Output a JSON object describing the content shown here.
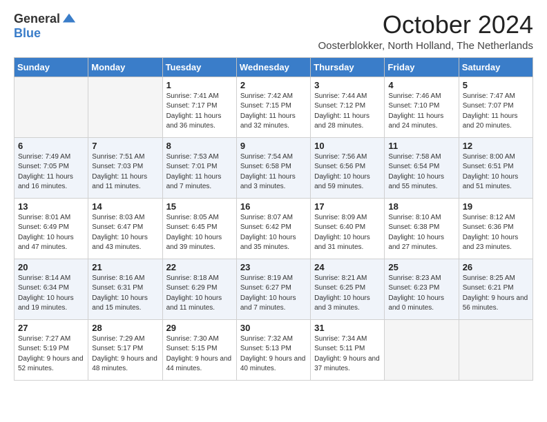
{
  "logo": {
    "general": "General",
    "blue": "Blue"
  },
  "title": "October 2024",
  "location": "Oosterblokker, North Holland, The Netherlands",
  "weekdays": [
    "Sunday",
    "Monday",
    "Tuesday",
    "Wednesday",
    "Thursday",
    "Friday",
    "Saturday"
  ],
  "weeks": [
    [
      {
        "day": "",
        "sunrise": "",
        "sunset": "",
        "daylight": "",
        "empty": true
      },
      {
        "day": "",
        "sunrise": "",
        "sunset": "",
        "daylight": "",
        "empty": true
      },
      {
        "day": "1",
        "sunrise": "Sunrise: 7:41 AM",
        "sunset": "Sunset: 7:17 PM",
        "daylight": "Daylight: 11 hours and 36 minutes."
      },
      {
        "day": "2",
        "sunrise": "Sunrise: 7:42 AM",
        "sunset": "Sunset: 7:15 PM",
        "daylight": "Daylight: 11 hours and 32 minutes."
      },
      {
        "day": "3",
        "sunrise": "Sunrise: 7:44 AM",
        "sunset": "Sunset: 7:12 PM",
        "daylight": "Daylight: 11 hours and 28 minutes."
      },
      {
        "day": "4",
        "sunrise": "Sunrise: 7:46 AM",
        "sunset": "Sunset: 7:10 PM",
        "daylight": "Daylight: 11 hours and 24 minutes."
      },
      {
        "day": "5",
        "sunrise": "Sunrise: 7:47 AM",
        "sunset": "Sunset: 7:07 PM",
        "daylight": "Daylight: 11 hours and 20 minutes."
      }
    ],
    [
      {
        "day": "6",
        "sunrise": "Sunrise: 7:49 AM",
        "sunset": "Sunset: 7:05 PM",
        "daylight": "Daylight: 11 hours and 16 minutes."
      },
      {
        "day": "7",
        "sunrise": "Sunrise: 7:51 AM",
        "sunset": "Sunset: 7:03 PM",
        "daylight": "Daylight: 11 hours and 11 minutes."
      },
      {
        "day": "8",
        "sunrise": "Sunrise: 7:53 AM",
        "sunset": "Sunset: 7:01 PM",
        "daylight": "Daylight: 11 hours and 7 minutes."
      },
      {
        "day": "9",
        "sunrise": "Sunrise: 7:54 AM",
        "sunset": "Sunset: 6:58 PM",
        "daylight": "Daylight: 11 hours and 3 minutes."
      },
      {
        "day": "10",
        "sunrise": "Sunrise: 7:56 AM",
        "sunset": "Sunset: 6:56 PM",
        "daylight": "Daylight: 10 hours and 59 minutes."
      },
      {
        "day": "11",
        "sunrise": "Sunrise: 7:58 AM",
        "sunset": "Sunset: 6:54 PM",
        "daylight": "Daylight: 10 hours and 55 minutes."
      },
      {
        "day": "12",
        "sunrise": "Sunrise: 8:00 AM",
        "sunset": "Sunset: 6:51 PM",
        "daylight": "Daylight: 10 hours and 51 minutes."
      }
    ],
    [
      {
        "day": "13",
        "sunrise": "Sunrise: 8:01 AM",
        "sunset": "Sunset: 6:49 PM",
        "daylight": "Daylight: 10 hours and 47 minutes."
      },
      {
        "day": "14",
        "sunrise": "Sunrise: 8:03 AM",
        "sunset": "Sunset: 6:47 PM",
        "daylight": "Daylight: 10 hours and 43 minutes."
      },
      {
        "day": "15",
        "sunrise": "Sunrise: 8:05 AM",
        "sunset": "Sunset: 6:45 PM",
        "daylight": "Daylight: 10 hours and 39 minutes."
      },
      {
        "day": "16",
        "sunrise": "Sunrise: 8:07 AM",
        "sunset": "Sunset: 6:42 PM",
        "daylight": "Daylight: 10 hours and 35 minutes."
      },
      {
        "day": "17",
        "sunrise": "Sunrise: 8:09 AM",
        "sunset": "Sunset: 6:40 PM",
        "daylight": "Daylight: 10 hours and 31 minutes."
      },
      {
        "day": "18",
        "sunrise": "Sunrise: 8:10 AM",
        "sunset": "Sunset: 6:38 PM",
        "daylight": "Daylight: 10 hours and 27 minutes."
      },
      {
        "day": "19",
        "sunrise": "Sunrise: 8:12 AM",
        "sunset": "Sunset: 6:36 PM",
        "daylight": "Daylight: 10 hours and 23 minutes."
      }
    ],
    [
      {
        "day": "20",
        "sunrise": "Sunrise: 8:14 AM",
        "sunset": "Sunset: 6:34 PM",
        "daylight": "Daylight: 10 hours and 19 minutes."
      },
      {
        "day": "21",
        "sunrise": "Sunrise: 8:16 AM",
        "sunset": "Sunset: 6:31 PM",
        "daylight": "Daylight: 10 hours and 15 minutes."
      },
      {
        "day": "22",
        "sunrise": "Sunrise: 8:18 AM",
        "sunset": "Sunset: 6:29 PM",
        "daylight": "Daylight: 10 hours and 11 minutes."
      },
      {
        "day": "23",
        "sunrise": "Sunrise: 8:19 AM",
        "sunset": "Sunset: 6:27 PM",
        "daylight": "Daylight: 10 hours and 7 minutes."
      },
      {
        "day": "24",
        "sunrise": "Sunrise: 8:21 AM",
        "sunset": "Sunset: 6:25 PM",
        "daylight": "Daylight: 10 hours and 3 minutes."
      },
      {
        "day": "25",
        "sunrise": "Sunrise: 8:23 AM",
        "sunset": "Sunset: 6:23 PM",
        "daylight": "Daylight: 10 hours and 0 minutes."
      },
      {
        "day": "26",
        "sunrise": "Sunrise: 8:25 AM",
        "sunset": "Sunset: 6:21 PM",
        "daylight": "Daylight: 9 hours and 56 minutes."
      }
    ],
    [
      {
        "day": "27",
        "sunrise": "Sunrise: 7:27 AM",
        "sunset": "Sunset: 5:19 PM",
        "daylight": "Daylight: 9 hours and 52 minutes."
      },
      {
        "day": "28",
        "sunrise": "Sunrise: 7:29 AM",
        "sunset": "Sunset: 5:17 PM",
        "daylight": "Daylight: 9 hours and 48 minutes."
      },
      {
        "day": "29",
        "sunrise": "Sunrise: 7:30 AM",
        "sunset": "Sunset: 5:15 PM",
        "daylight": "Daylight: 9 hours and 44 minutes."
      },
      {
        "day": "30",
        "sunrise": "Sunrise: 7:32 AM",
        "sunset": "Sunset: 5:13 PM",
        "daylight": "Daylight: 9 hours and 40 minutes."
      },
      {
        "day": "31",
        "sunrise": "Sunrise: 7:34 AM",
        "sunset": "Sunset: 5:11 PM",
        "daylight": "Daylight: 9 hours and 37 minutes."
      },
      {
        "day": "",
        "sunrise": "",
        "sunset": "",
        "daylight": "",
        "empty": true
      },
      {
        "day": "",
        "sunrise": "",
        "sunset": "",
        "daylight": "",
        "empty": true
      }
    ]
  ],
  "row_colors": [
    "#ffffff",
    "#f0f4fa",
    "#ffffff",
    "#f0f4fa",
    "#ffffff"
  ]
}
